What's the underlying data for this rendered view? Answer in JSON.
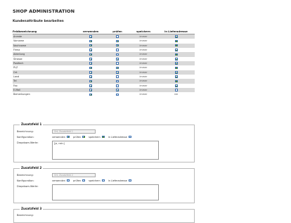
{
  "header": {
    "title": "SHOP ADMINISTRATION",
    "subtitle": "Kundenattribute bearbeiten"
  },
  "table": {
    "columns": [
      "Feldbezeichnung",
      "verwenden",
      "prüfen",
      "speichern",
      "in Lieferadresse"
    ],
    "rows": [
      {
        "label": "Anrede",
        "use": true,
        "check": false,
        "save": "immer",
        "delivery": true
      },
      {
        "label": "Vorname",
        "use": true,
        "check": true,
        "save": "immer",
        "delivery": true
      },
      {
        "label": "Nachname",
        "use": true,
        "check": true,
        "save": "immer",
        "delivery": true
      },
      {
        "label": "Firma",
        "use": true,
        "check": false,
        "save": "immer",
        "delivery": true
      },
      {
        "label": "Abteilung",
        "use": true,
        "check": false,
        "save": "immer",
        "delivery": true
      },
      {
        "label": "Strasse",
        "use": true,
        "check": true,
        "save": "immer",
        "delivery": true
      },
      {
        "label": "Postfach",
        "use": true,
        "check": false,
        "save": "immer",
        "delivery": true
      },
      {
        "label": "PLZ",
        "use": true,
        "check": true,
        "save": "immer",
        "delivery": true
      },
      {
        "label": "Ort",
        "use": true,
        "check": true,
        "save": "immer",
        "delivery": true
      },
      {
        "label": "Land",
        "use": true,
        "check": false,
        "save": "immer",
        "delivery": true
      },
      {
        "label": "Tel",
        "use": true,
        "check": false,
        "save": "immer",
        "delivery": true
      },
      {
        "label": "Fax",
        "use": true,
        "check": false,
        "save": "immer",
        "delivery": true
      },
      {
        "label": "E-Mail",
        "use": true,
        "check": true,
        "save": "immer",
        "delivery": false
      },
      {
        "label": "Bemerkungen",
        "use": true,
        "check": false,
        "save": "immer",
        "delivery": "nie"
      }
    ]
  },
  "zusatzfelder": [
    {
      "legend": "Zusatzfeld 1",
      "bezeichnung_label": "Bezeichnung:",
      "bezeichnung_value": "Ort, Zusatzfeld 1",
      "konfiguration_label": "Konfiguration:",
      "verwenden_label": "verwenden",
      "pruefen_label": "prüfen",
      "speichern_label": "speichern",
      "lieferadresse_label": "in Lieferadresse",
      "verwenden": true,
      "pruefen": true,
      "speichern": true,
      "lieferadresse": false,
      "dropdown_label": "Dropdown-Werte:",
      "dropdown_value": "[ja, nein]"
    },
    {
      "legend": "Zusatzfeld 2",
      "bezeichnung_label": "Bezeichnung:",
      "bezeichnung_value": "Ort, Zusatzfeld 2",
      "konfiguration_label": "Konfiguration:",
      "verwenden_label": "verwenden",
      "pruefen_label": "prüfen",
      "speichern_label": "speichern",
      "lieferadresse_label": "in Lieferadresse",
      "verwenden": false,
      "pruefen": false,
      "speichern": false,
      "lieferadresse": false,
      "dropdown_label": "Dropdown-Werte:",
      "dropdown_value": ""
    },
    {
      "legend": "Zusatzfeld 3",
      "bezeichnung_label": "Bezeichnung:"
    }
  ]
}
